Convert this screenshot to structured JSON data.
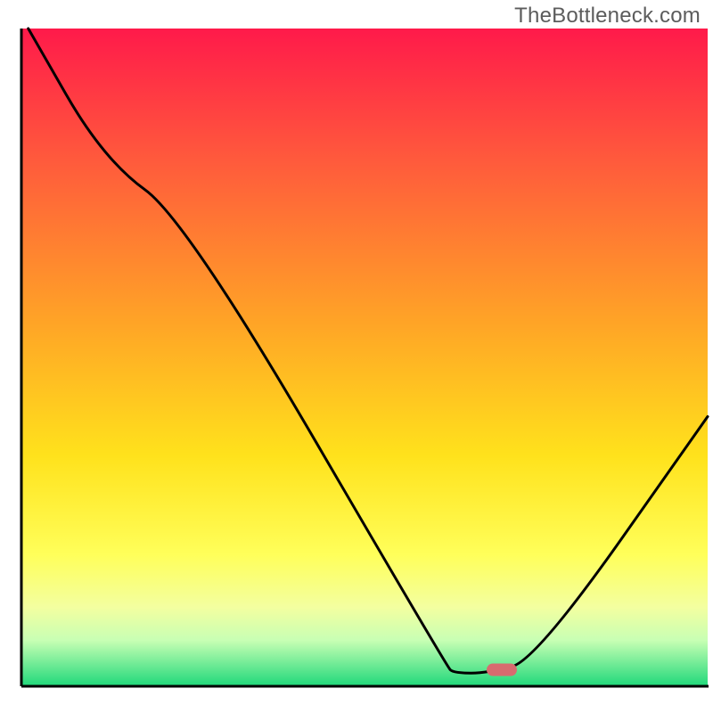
{
  "watermark": "TheBottleneck.com",
  "chart_data": {
    "type": "line",
    "title": "",
    "xlabel": "",
    "ylabel": "",
    "xlim": [
      0,
      100
    ],
    "ylim": [
      0,
      100
    ],
    "grid": false,
    "background": "red-to-green vertical gradient",
    "curve": {
      "name": "bottleneck-curve",
      "color": "#000000",
      "points": [
        {
          "x": 1,
          "y": 100
        },
        {
          "x": 12,
          "y": 80
        },
        {
          "x": 24,
          "y": 71
        },
        {
          "x": 62,
          "y": 3
        },
        {
          "x": 63,
          "y": 2
        },
        {
          "x": 68,
          "y": 2
        },
        {
          "x": 75,
          "y": 4
        },
        {
          "x": 100,
          "y": 41
        }
      ]
    },
    "marker": {
      "name": "optimal-point",
      "center_x": 70,
      "center_y": 2.5,
      "color": "#d86b6f"
    },
    "gradient_stops": [
      {
        "offset": 0,
        "color": "#ff1a4a"
      },
      {
        "offset": 20,
        "color": "#ff5a3c"
      },
      {
        "offset": 45,
        "color": "#ffa526"
      },
      {
        "offset": 65,
        "color": "#ffe21c"
      },
      {
        "offset": 80,
        "color": "#ffff5a"
      },
      {
        "offset": 88,
        "color": "#f3ffa0"
      },
      {
        "offset": 93,
        "color": "#c8ffb4"
      },
      {
        "offset": 100,
        "color": "#1fd87a"
      }
    ]
  }
}
